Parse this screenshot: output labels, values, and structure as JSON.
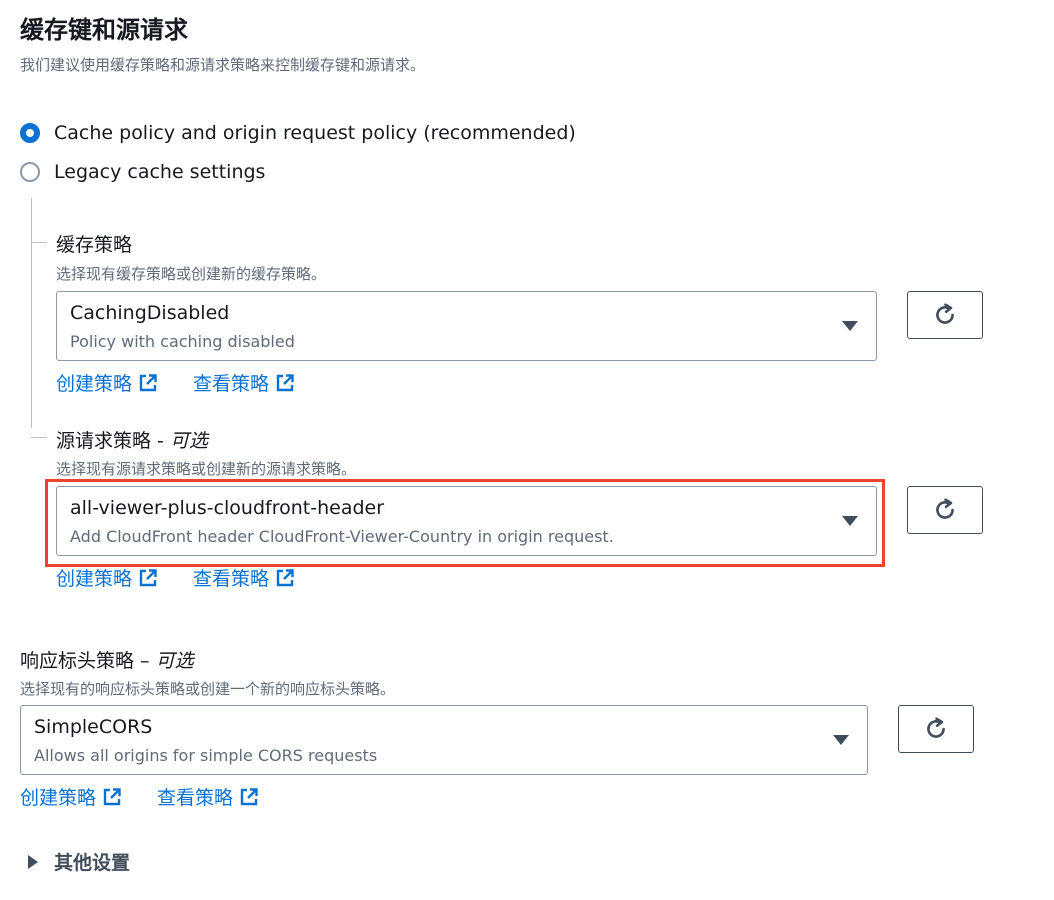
{
  "header": {
    "title": "缓存键和源请求",
    "description": "我们建议使用缓存策略和源请求策略来控制缓存键和源请求。"
  },
  "options": [
    {
      "label": "Cache policy and origin request policy (recommended)",
      "checked": true
    },
    {
      "label": "Legacy cache settings",
      "checked": false
    }
  ],
  "cache_policy": {
    "label": "缓存策略",
    "description": "选择现有缓存策略或创建新的缓存策略。",
    "value": "CachingDisabled",
    "sub": "Policy with caching disabled",
    "create_link": "创建策略",
    "view_link": "查看策略"
  },
  "origin_policy": {
    "label": "源请求策略 - ",
    "optional": "可选",
    "description": "选择现有源请求策略或创建新的源请求策略。",
    "value": "all-viewer-plus-cloudfront-header",
    "sub": "Add CloudFront header CloudFront-Viewer-Country in origin request.",
    "create_link": "创建策略",
    "view_link": "查看策略"
  },
  "response_policy": {
    "label": "响应标头策略 – ",
    "optional": "可选",
    "description": "选择现有的响应标头策略或创建一个新的响应标头策略。",
    "value": "SimpleCORS",
    "sub": "Allows all origins for simple CORS requests",
    "create_link": "创建策略",
    "view_link": "查看策略"
  },
  "additional": {
    "label": "其他设置"
  },
  "colors": {
    "accent": "#0972d3",
    "highlight": "#e8442e",
    "border": "#8d99a8"
  }
}
